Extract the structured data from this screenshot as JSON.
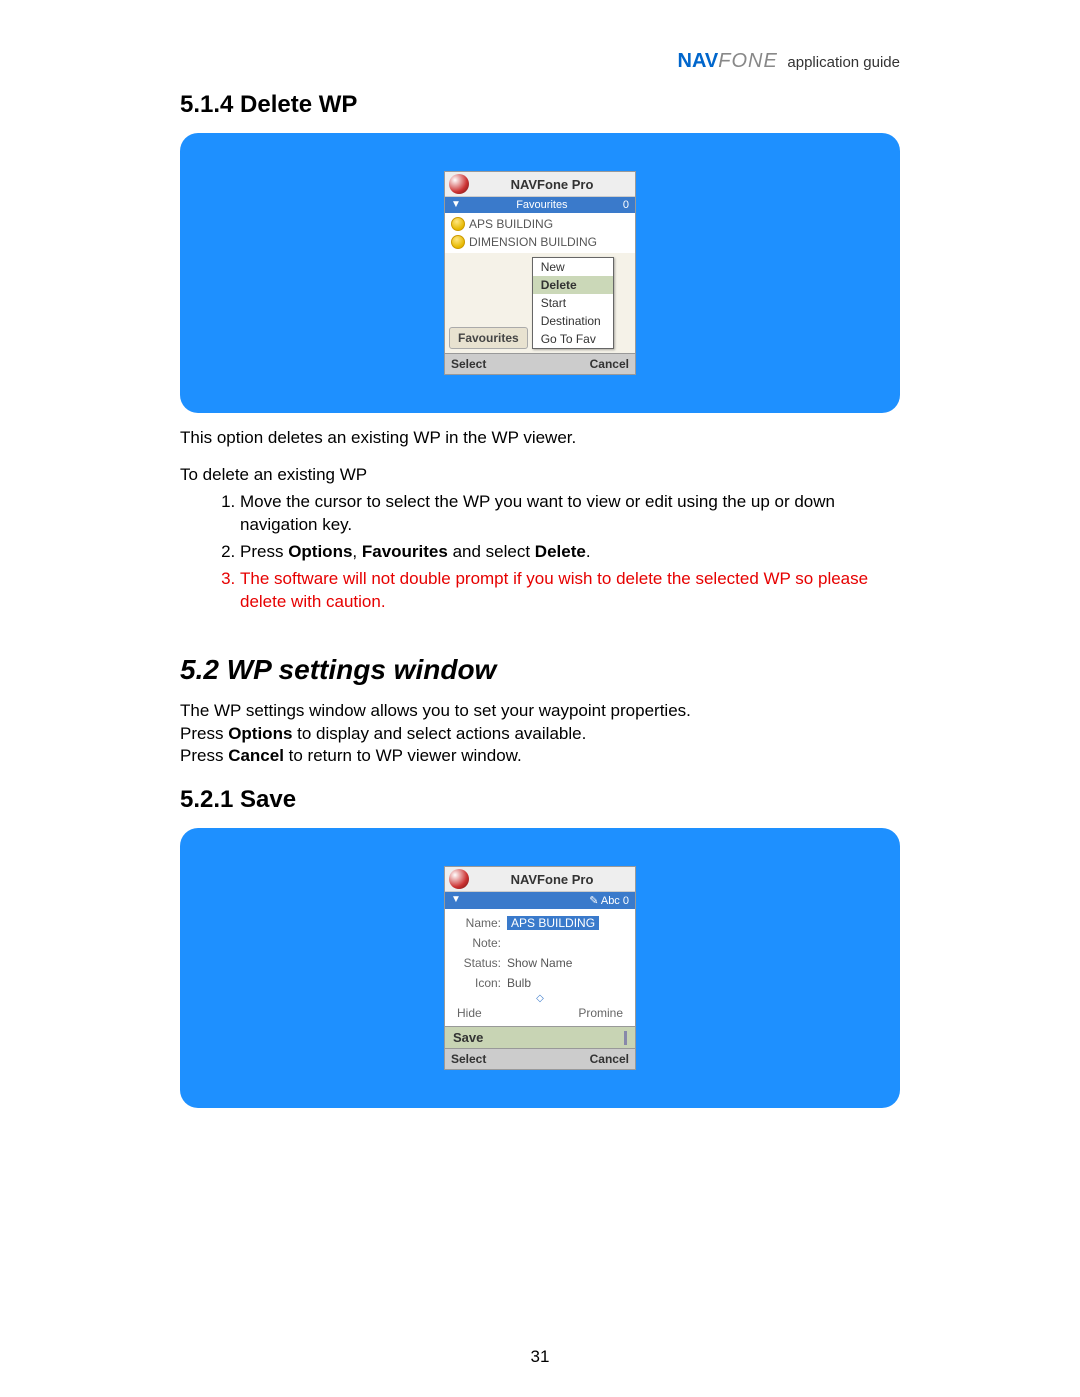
{
  "header": {
    "logo_nav": "NAV",
    "logo_fone": "FONE",
    "guide": "application guide"
  },
  "section1": {
    "heading": "5.1.4 Delete WP",
    "phone": {
      "title": "NAVFone Pro",
      "bar_left": "▼",
      "bar_center": "Favourites",
      "bar_right": "0",
      "items": [
        "APS BUILDING",
        "DIMENSION BUILDING"
      ],
      "fav_btn": "Favourites",
      "menu": [
        "New",
        "Delete",
        "Start",
        "Destination",
        "Go To Fav"
      ],
      "menu_selected": "Delete",
      "soft_left": "Select",
      "soft_right": "Cancel"
    },
    "para1": "This option deletes an existing WP in the WP viewer.",
    "para2": "To delete an existing WP",
    "step1": "Move the cursor to select the WP you want to view or edit using the up or down navigation key.",
    "step2_pre": "Press ",
    "step2_b1": "Options",
    "step2_mid1": ", ",
    "step2_b2": "Favourites",
    "step2_mid2": " and select ",
    "step2_b3": "Delete",
    "step2_post": ".",
    "step3": "The software will not double prompt if you wish to delete the selected WP so please delete with caution."
  },
  "section2": {
    "heading": "5.2 WP settings window",
    "para1": "The WP settings window allows you to set your waypoint properties.",
    "para2_pre": "Press ",
    "para2_b": "Options",
    "para2_post": " to display and select actions available.",
    "para3_pre": "Press ",
    "para3_b": "Cancel",
    "para3_post": " to return to WP viewer window."
  },
  "section3": {
    "heading": "5.2.1 Save",
    "phone": {
      "title": "NAVFone Pro",
      "bar_right": "✎ Abc  0",
      "name_lbl": "Name:",
      "name_val": "APS BUILDING",
      "note_lbl": "Note:",
      "status_lbl": "Status:",
      "status_val": "Show Name",
      "icon_lbl": "Icon:",
      "icon_val": "Bulb",
      "hide": "Hide",
      "promine": "Promine",
      "save": "Save",
      "soft_left": "Select",
      "soft_right": "Cancel"
    }
  },
  "page_number": "31"
}
